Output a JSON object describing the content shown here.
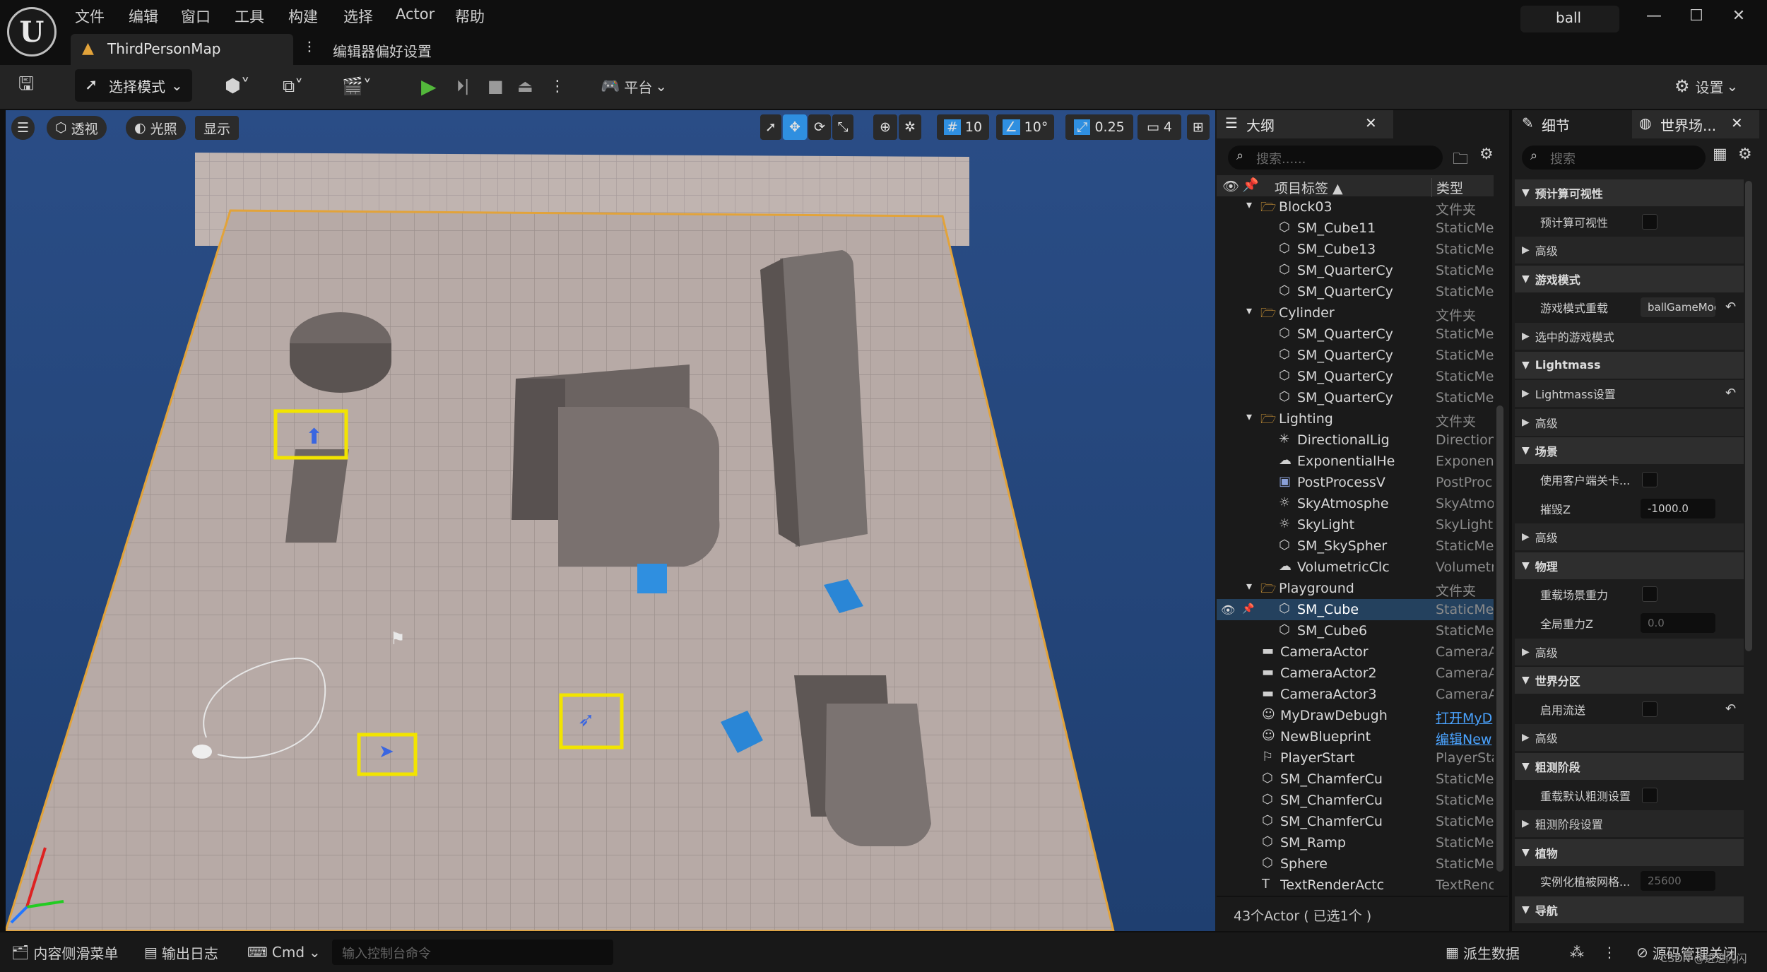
{
  "menu": [
    "文件",
    "编辑",
    "窗口",
    "工具",
    "构建",
    "选择",
    "Actor",
    "帮助"
  ],
  "project_name": "ball",
  "tabs": {
    "level_tab": "ThirdPersonMap",
    "prefs_tab": "编辑器偏好设置"
  },
  "toolbar": {
    "mode_label": "选择模式",
    "platform_label": "平台",
    "settings_label": "设置"
  },
  "viewport": {
    "perspective_label": "透视",
    "lit_label": "光照",
    "show_label": "显示",
    "grid_snap": "10",
    "rotate_snap": "10°",
    "scale_snap": "0.25",
    "camera_speed": "4"
  },
  "outliner": {
    "title": "大纲",
    "search_placeholder": "搜索......",
    "col_label": "项目标签 ▲",
    "col_type": "类型",
    "rows": [
      {
        "name": "Block03",
        "type": "文件夹",
        "level": 2,
        "kind": "folder",
        "open": true
      },
      {
        "name": "SM_Cube11",
        "type": "StaticMe",
        "level": 3,
        "kind": "mesh"
      },
      {
        "name": "SM_Cube13",
        "type": "StaticMe",
        "level": 3,
        "kind": "mesh"
      },
      {
        "name": "SM_QuarterCy",
        "type": "StaticMe",
        "level": 3,
        "kind": "mesh"
      },
      {
        "name": "SM_QuarterCy",
        "type": "StaticMe",
        "level": 3,
        "kind": "mesh"
      },
      {
        "name": "Cylinder",
        "type": "文件夹",
        "level": 2,
        "kind": "folder",
        "open": true
      },
      {
        "name": "SM_QuarterCy",
        "type": "StaticMe",
        "level": 3,
        "kind": "mesh"
      },
      {
        "name": "SM_QuarterCy",
        "type": "StaticMe",
        "level": 3,
        "kind": "mesh"
      },
      {
        "name": "SM_QuarterCy",
        "type": "StaticMe",
        "level": 3,
        "kind": "mesh"
      },
      {
        "name": "SM_QuarterCy",
        "type": "StaticMe",
        "level": 3,
        "kind": "mesh"
      },
      {
        "name": "Lighting",
        "type": "文件夹",
        "level": 2,
        "kind": "folder",
        "open": true
      },
      {
        "name": "DirectionalLig",
        "type": "Direction",
        "level": 3,
        "kind": "light"
      },
      {
        "name": "ExponentialHe",
        "type": "Exponent",
        "level": 3,
        "kind": "cloud"
      },
      {
        "name": "PostProcessV",
        "type": "PostProc",
        "level": 3,
        "kind": "box"
      },
      {
        "name": "SkyAtmosphe",
        "type": "SkyAtmo",
        "level": 3,
        "kind": "sun"
      },
      {
        "name": "SkyLight",
        "type": "SkyLight",
        "level": 3,
        "kind": "sun"
      },
      {
        "name": "SM_SkySpher",
        "type": "StaticMe",
        "level": 3,
        "kind": "mesh"
      },
      {
        "name": "VolumetricClc",
        "type": "Volumetr",
        "level": 3,
        "kind": "cloud"
      },
      {
        "name": "Playground",
        "type": "文件夹",
        "level": 2,
        "kind": "folder",
        "open": true
      },
      {
        "name": "SM_Cube",
        "type": "StaticMe",
        "level": 3,
        "kind": "mesh",
        "selected": true
      },
      {
        "name": "SM_Cube6",
        "type": "StaticMe",
        "level": 3,
        "kind": "mesh"
      },
      {
        "name": "CameraActor",
        "type": "CameraA",
        "level": 2,
        "kind": "camera"
      },
      {
        "name": "CameraActor2",
        "type": "CameraA",
        "level": 2,
        "kind": "camera"
      },
      {
        "name": "CameraActor3",
        "type": "CameraA",
        "level": 2,
        "kind": "camera"
      },
      {
        "name": "MyDrawDebugh",
        "type": "打开MyD",
        "level": 2,
        "kind": "person",
        "link": true
      },
      {
        "name": "NewBlueprint",
        "type": "编辑New",
        "level": 2,
        "kind": "person",
        "link": true
      },
      {
        "name": "PlayerStart",
        "type": "PlayerSta",
        "level": 2,
        "kind": "game"
      },
      {
        "name": "SM_ChamferCu",
        "type": "StaticMe",
        "level": 2,
        "kind": "mesh"
      },
      {
        "name": "SM_ChamferCu",
        "type": "StaticMe",
        "level": 2,
        "kind": "mesh"
      },
      {
        "name": "SM_ChamferCu",
        "type": "StaticMe",
        "level": 2,
        "kind": "mesh"
      },
      {
        "name": "SM_Ramp",
        "type": "StaticMe",
        "level": 2,
        "kind": "mesh"
      },
      {
        "name": "Sphere",
        "type": "StaticMe",
        "level": 2,
        "kind": "mesh"
      },
      {
        "name": "TextRenderActc",
        "type": "TextRenc",
        "level": 2,
        "kind": "text"
      }
    ],
    "footer": "43个Actor ( 已选1个 )"
  },
  "details": {
    "tab_details": "细节",
    "tab_world": "世界场...",
    "search_placeholder": "搜索",
    "rows": [
      {
        "label": "预计算可视性",
        "kind": "cat",
        "open": true
      },
      {
        "label": "预计算可视性",
        "kind": "prop",
        "control": "checkbox"
      },
      {
        "label": "高级",
        "kind": "sub"
      },
      {
        "label": "游戏模式",
        "kind": "cat",
        "open": true
      },
      {
        "label": "游戏模式重载",
        "kind": "prop",
        "control": "field",
        "value": "ballGameMoc",
        "reset": true
      },
      {
        "label": "选中的游戏模式",
        "kind": "sub"
      },
      {
        "label": "Lightmass",
        "kind": "cat",
        "open": true
      },
      {
        "label": "Lightmass设置",
        "kind": "sub",
        "reset": true
      },
      {
        "label": "高级",
        "kind": "sub"
      },
      {
        "label": "场景",
        "kind": "cat",
        "open": true
      },
      {
        "label": "使用客户端关卡...",
        "kind": "prop",
        "control": "checkbox"
      },
      {
        "label": "摧毁Z",
        "kind": "prop",
        "control": "field",
        "value": "-1000.0"
      },
      {
        "label": "高级",
        "kind": "sub"
      },
      {
        "label": "物理",
        "kind": "cat",
        "open": true
      },
      {
        "label": "重载场景重力",
        "kind": "prop",
        "control": "checkbox"
      },
      {
        "label": "全局重力Z",
        "kind": "prop",
        "control": "field",
        "value": "0.0",
        "disabled": true
      },
      {
        "label": "高级",
        "kind": "sub"
      },
      {
        "label": "世界分区",
        "kind": "cat",
        "open": true
      },
      {
        "label": "启用流送",
        "kind": "prop",
        "control": "checkbox",
        "reset": true
      },
      {
        "label": "高级",
        "kind": "sub"
      },
      {
        "label": "粗测阶段",
        "kind": "cat",
        "open": true
      },
      {
        "label": "重载默认粗测设置",
        "kind": "prop",
        "control": "checkbox"
      },
      {
        "label": "粗测阶段设置",
        "kind": "sub"
      },
      {
        "label": "植物",
        "kind": "cat",
        "open": true
      },
      {
        "label": "实例化植被网格...",
        "kind": "prop",
        "control": "field",
        "value": "25600",
        "disabled": true
      },
      {
        "label": "导航",
        "kind": "cat",
        "open": true
      }
    ]
  },
  "statusbar": {
    "content_drawer": "内容侧滑菜单",
    "output_log": "输出日志",
    "cmd_label": "Cmd",
    "cmd_placeholder": "输入控制台命令",
    "derived_data": "派生数据",
    "source_control": "源码管理关闭"
  },
  "watermark": "CSDN @进进闪闪",
  "colors": {
    "accent_blue": "#2f8fe0",
    "play_green": "#53b83b",
    "highlight_yellow": "#f2e400",
    "floor_orange": "#e2a33a",
    "selection": "#24415e"
  }
}
